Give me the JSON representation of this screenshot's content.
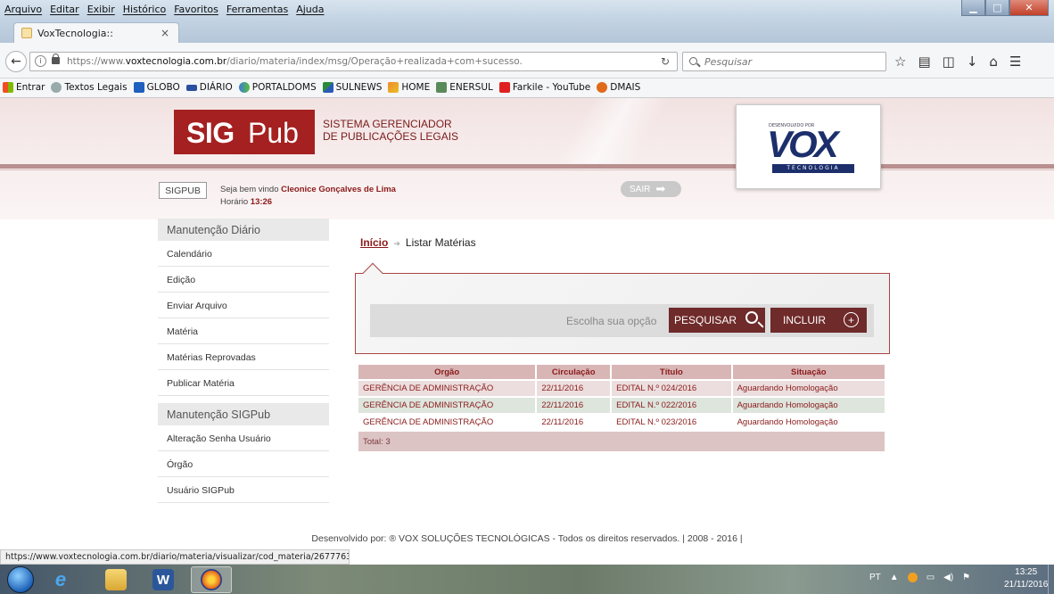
{
  "browser": {
    "menu": [
      "Arquivo",
      "Editar",
      "Exibir",
      "Histórico",
      "Favoritos",
      "Ferramentas",
      "Ajuda"
    ],
    "tab_title": "VoxTecnologia::",
    "url_prefix": "https://www.",
    "url_domain": "voxtecnologia.com.br",
    "url_path": "/diario/materia/index/msg/Operação+realizada+com+sucesso.",
    "search_placeholder": "Pesquisar",
    "bookmarks": [
      "Entrar",
      "Textos Legais",
      "GLOBO",
      "DIÁRIO",
      "PORTALDOMS",
      "SULNEWS",
      "HOME",
      "ENERSUL",
      "Farkile - YouTube",
      "DMAIS"
    ],
    "status_url": "https://www.voxtecnologia.com.br/diario/materia/visualizar/cod_materia/2677763"
  },
  "header": {
    "logo_bold": "SIG",
    "logo_light": "Pub",
    "tagline_1": "SISTEMA GERENCIADOR",
    "tagline_2": "DE PUBLICAÇÕES LEGAIS",
    "vox_dev": "DESENVOLVIDO POR",
    "vox_name": "VOX",
    "vox_sub": "TECNOLOGIA",
    "sigpub_btn": "SIGPUB",
    "welcome_label": "Seja bem vindo",
    "user_name": "Cleonice Gonçalves de Lima",
    "time_label": "Horário",
    "time_value": "13:26",
    "logout": "SAIR"
  },
  "sidebar": {
    "group1": "Manutenção Diário",
    "items1": [
      "Calendário",
      "Edição",
      "Enviar Arquivo",
      "Matéria",
      "Matérias Reprovadas",
      "Publicar Matéria"
    ],
    "group2": "Manutenção SIGPub",
    "items2": [
      "Alteração Senha Usuário",
      "Órgão",
      "Usuário SIGPub"
    ]
  },
  "content": {
    "crumb_home": "Início",
    "crumb_current": "Listar Matérias",
    "option_label": "Escolha sua opção",
    "search_btn": "PESQUISAR",
    "include_btn": "INCLUIR",
    "columns": [
      "Orgão",
      "Circulação",
      "Título",
      "Situação"
    ],
    "rows": [
      [
        "GERÊNCIA DE ADMINISTRAÇÃO",
        "22/11/2016",
        "EDITAL N.º 024/2016",
        "Aguardando Homologação"
      ],
      [
        "GERÊNCIA DE ADMINISTRAÇÃO",
        "22/11/2016",
        "EDITAL N.º 022/2016",
        "Aguardando Homologação"
      ],
      [
        "GERÊNCIA DE ADMINISTRAÇÃO",
        "22/11/2016",
        "EDITAL N.º 023/2016",
        "Aguardando Homologação"
      ]
    ],
    "total": "Total: 3"
  },
  "footer": "Desenvolvido por: ® VOX SOLUÇÕES TECNOLÓGICAS - Todos os direitos reservados. | 2008 - 2016 |",
  "taskbar": {
    "lang": "PT",
    "time": "13:25",
    "date": "21/11/2016"
  }
}
